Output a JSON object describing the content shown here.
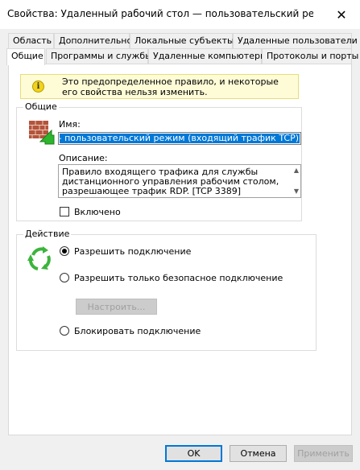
{
  "window": {
    "title": "Свойства: Удаленный рабочий стол — пользовательский режим (входя...",
    "close_glyph": "✕"
  },
  "tabs_row1": [
    "Область",
    "Дополнительно",
    "Локальные субъекты",
    "Удаленные пользователи"
  ],
  "tabs_row2": [
    "Общие",
    "Программы и службы",
    "Удаленные компьютеры",
    "Протоколы и порты"
  ],
  "active_tab": "Общие",
  "info": {
    "icon": "info-icon",
    "text": "Это предопределенное правило, и некоторые его свойства нельзя изменить."
  },
  "general": {
    "group_label": "Общие",
    "name_label": "Имя:",
    "name_value": "Удаленный рабочий стол – пользовательский режим (входящий трафик TCP)",
    "description_label": "Описание:",
    "description_value": "Правило входящего трафика для службы дистанционного управления рабочим столом, разрешающее трафик RDP. [TCP 3389]",
    "enabled_label": "Включено",
    "enabled_checked": false
  },
  "action": {
    "group_label": "Действие",
    "allow_label": "Разрешить подключение",
    "allow_secure_label": "Разрешить только безопасное подключение",
    "customize_label": "Настроить...",
    "block_label": "Блокировать подключение",
    "selected": "allow"
  },
  "buttons": {
    "ok": "OK",
    "cancel": "Отмена",
    "apply": "Применить"
  }
}
